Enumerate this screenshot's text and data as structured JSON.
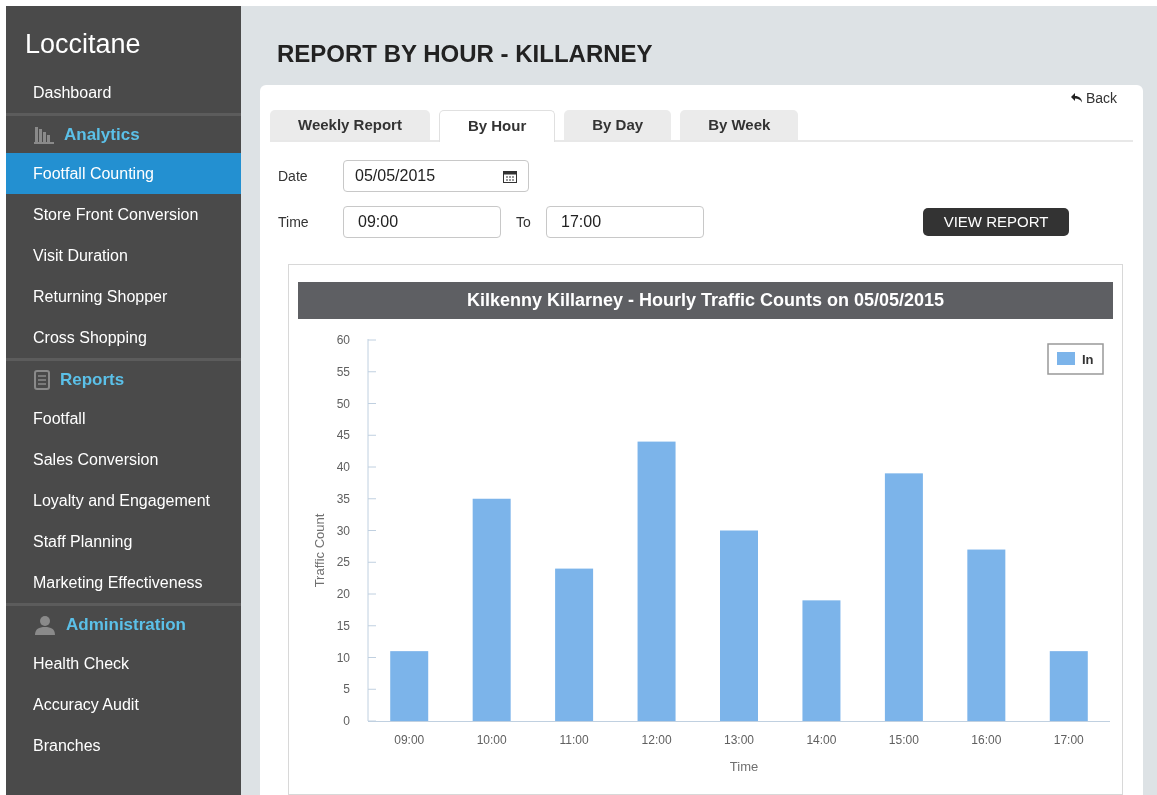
{
  "sidebar": {
    "brand": "Loccitane",
    "items": [
      {
        "kind": "link",
        "label": "Dashboard",
        "selected": false
      },
      {
        "kind": "header",
        "label": "Analytics"
      },
      {
        "kind": "link",
        "label": "Footfall Counting",
        "selected": true
      },
      {
        "kind": "link",
        "label": "Store Front Conversion",
        "selected": false
      },
      {
        "kind": "link",
        "label": "Visit Duration",
        "selected": false
      },
      {
        "kind": "link",
        "label": "Returning Shopper",
        "selected": false
      },
      {
        "kind": "link",
        "label": "Cross Shopping",
        "selected": false
      },
      {
        "kind": "header",
        "label": "Reports"
      },
      {
        "kind": "link",
        "label": "Footfall",
        "selected": false
      },
      {
        "kind": "link",
        "label": "Sales Conversion",
        "selected": false
      },
      {
        "kind": "link",
        "label": "Loyalty and Engagement",
        "selected": false
      },
      {
        "kind": "link",
        "label": "Staff Planning",
        "selected": false
      },
      {
        "kind": "link",
        "label": "Marketing Effectiveness",
        "selected": false
      },
      {
        "kind": "header",
        "label": "Administration"
      },
      {
        "kind": "link",
        "label": "Health Check",
        "selected": false
      },
      {
        "kind": "link",
        "label": "Accuracy Audit",
        "selected": false
      },
      {
        "kind": "link",
        "label": "Branches",
        "selected": false
      }
    ]
  },
  "page": {
    "title": "REPORT BY HOUR - KILLARNEY",
    "back": "Back"
  },
  "tabs": [
    {
      "label": "Weekly Report",
      "selected": false
    },
    {
      "label": "By Hour",
      "selected": true
    },
    {
      "label": "By Day",
      "selected": false
    },
    {
      "label": "By Week",
      "selected": false
    }
  ],
  "form": {
    "date_label": "Date",
    "date": "05/05/2015",
    "time_label": "Time",
    "time_from": "09:00",
    "to_label": "To",
    "time_to": "17:00",
    "button": "VIEW REPORT"
  },
  "chart": {
    "chart_data": {
      "type": "bar",
      "title": "Kilkenny Killarney - Hourly Traffic Counts on 05/05/2015",
      "xlabel": "Time",
      "ylabel": "Traffic Count",
      "categories": [
        "09:00",
        "10:00",
        "11:00",
        "12:00",
        "13:00",
        "14:00",
        "15:00",
        "16:00",
        "17:00"
      ],
      "series": [
        {
          "name": "In",
          "color": "#7cb4ea",
          "values": [
            11,
            35,
            24,
            44,
            30,
            19,
            39,
            27,
            11
          ]
        }
      ],
      "ylim": [
        0,
        60
      ],
      "yticks": [
        0,
        5,
        10,
        15,
        20,
        25,
        30,
        35,
        40,
        45,
        50,
        55,
        60
      ]
    }
  }
}
